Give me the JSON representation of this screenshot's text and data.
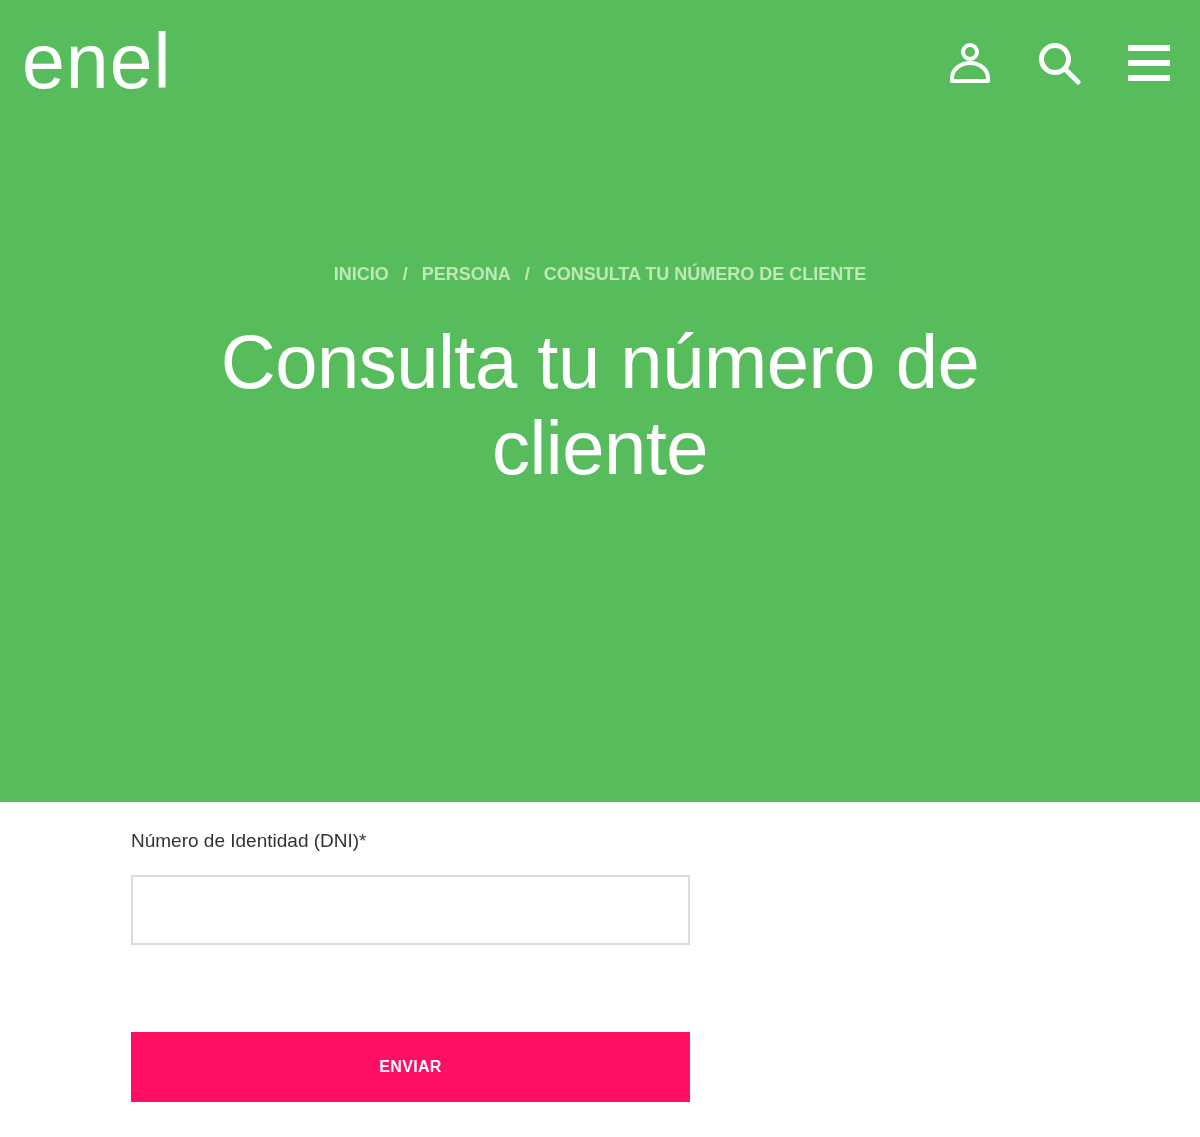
{
  "header": {
    "logo": "enel"
  },
  "hero": {
    "breadcrumb": [
      {
        "kind": "link",
        "text": "INICIO"
      },
      {
        "kind": "separator",
        "text": "/"
      },
      {
        "kind": "link",
        "text": "PERSONA"
      },
      {
        "kind": "separator",
        "text": "/"
      },
      {
        "kind": "current",
        "text": "CONSULTA TU NÚMERO DE CLIENTE"
      }
    ],
    "title": "Consulta tu número de cliente"
  },
  "form": {
    "field": {
      "label": "Número de Identidad (DNI)*"
    },
    "submit": "ENVIAR"
  }
}
